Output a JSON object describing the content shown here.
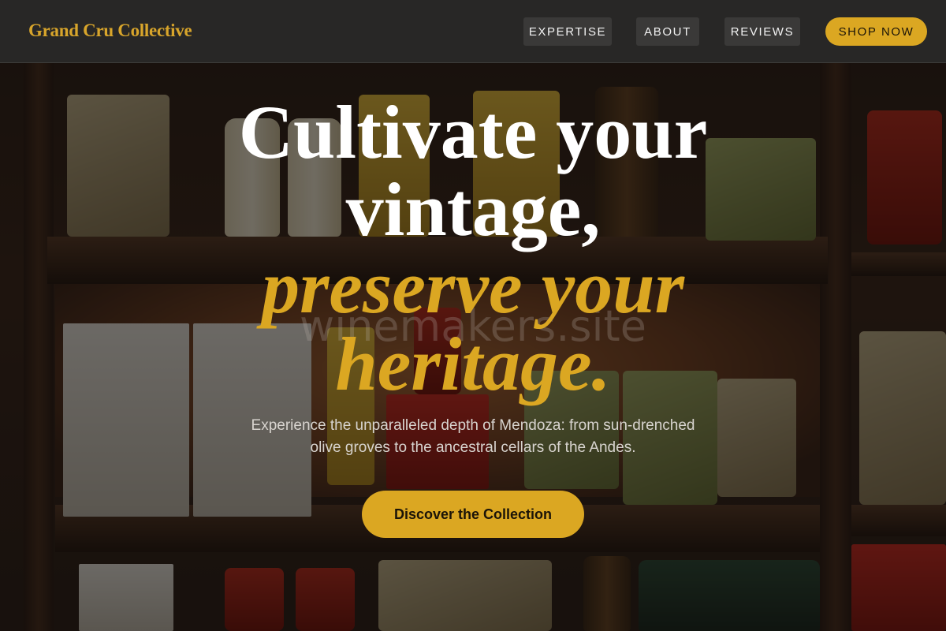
{
  "header": {
    "brand": "Grand Cru Collective",
    "nav": [
      {
        "label": "EXPERTISE"
      },
      {
        "label": "ABOUT"
      },
      {
        "label": "REVIEWS"
      }
    ],
    "shop_label": "SHOP NOW"
  },
  "hero": {
    "title_line1": "Cultivate your",
    "title_line2": "vintage,",
    "title_line3": "preserve your",
    "title_line4": "heritage.",
    "watermark": "winemakers.site",
    "subtitle_line1": "Experience the unparalleled depth of Mendoza: from sun-drenched",
    "subtitle_line2": "olive groves to the ancestral cellars of the Andes.",
    "cta_label": "Discover the Collection"
  },
  "colors": {
    "accent": "#dba722",
    "header_bg": "#282726",
    "nav_bg": "#3a3938",
    "title": "#ffffff"
  }
}
